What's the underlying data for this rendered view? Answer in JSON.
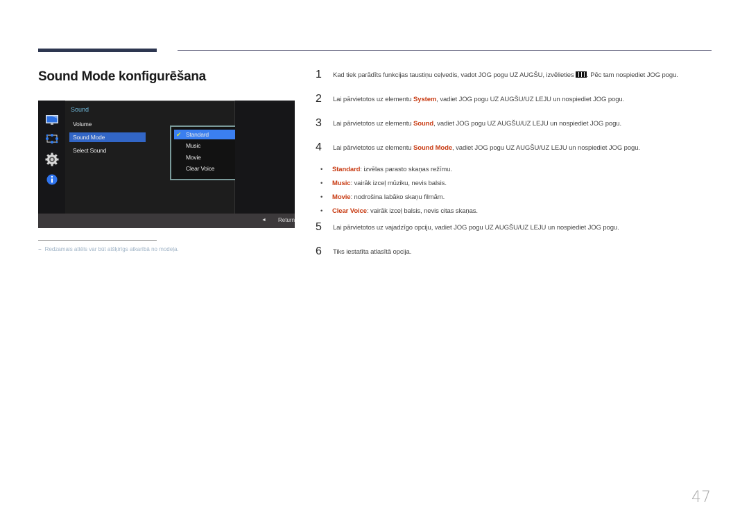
{
  "page": {
    "title": "Sound Mode konfigurēšana",
    "number": "47"
  },
  "osd": {
    "icons": [
      "monitor-icon",
      "resize-icon",
      "gear-icon",
      "info-icon"
    ],
    "section": "Sound",
    "menu_items": [
      {
        "label": "Volume",
        "active": false
      },
      {
        "label": "Sound Mode",
        "active": true
      },
      {
        "label": "Select Sound",
        "active": false
      }
    ],
    "submenu_items": [
      {
        "label": "Standard",
        "selected": true
      },
      {
        "label": "Music",
        "selected": false
      },
      {
        "label": "Movie",
        "selected": false
      },
      {
        "label": "Clear Voice",
        "selected": false
      }
    ],
    "footer": {
      "arrow": "◄",
      "return_label": "Return"
    },
    "colors": {
      "highlight": "#3266c6",
      "section": "#6fb7d8",
      "check": "#d8e830"
    }
  },
  "note": {
    "dash": "−",
    "text": "Redzamais attēls var būt atšķirīgs atkarībā no modeļa."
  },
  "steps": [
    {
      "num": "1",
      "before": "Kad tiek parādīts funkcijas taustiņu ceļvedis, vadot JOG pogu UZ AUGŠU, izvēlieties ",
      "highlight": "",
      "after": ". Pēc tam nospiediet JOG pogu.",
      "icon": "menu-icon"
    },
    {
      "num": "2",
      "before": "Lai pārvietotos uz elementu ",
      "highlight": "System",
      "after": ", vadiet JOG pogu UZ AUGŠU/UZ LEJU un nospiediet JOG pogu."
    },
    {
      "num": "3",
      "before": "Lai pārvietotos uz elementu ",
      "highlight": "Sound",
      "after": ", vadiet JOG pogu UZ AUGŠU/UZ LEJU un nospiediet JOG pogu."
    },
    {
      "num": "4",
      "before": "Lai pārvietotos uz elementu ",
      "highlight": "Sound Mode",
      "after": ", vadiet JOG pogu UZ AUGŠU/UZ LEJU un nospiediet JOG pogu."
    },
    {
      "num": "5",
      "before": "Lai pārvietotos uz vajadzīgo opciju, vadiet JOG pogu UZ AUGŠU/UZ LEJU un nospiediet JOG pogu.",
      "highlight": "",
      "after": ""
    },
    {
      "num": "6",
      "before": "Tiks iestatīta atlasītā opcija.",
      "highlight": "",
      "after": ""
    }
  ],
  "bullets": [
    {
      "dot": "•",
      "term": "Standard",
      "desc": ": izvēlas parasto skaņas režīmu."
    },
    {
      "dot": "•",
      "term": "Music",
      "desc": ": vairāk izceļ mūziku, nevis balsis."
    },
    {
      "dot": "•",
      "term": "Movie",
      "desc": ": nodrošina labāko skaņu filmām."
    },
    {
      "dot": "•",
      "term": "Clear Voice",
      "desc": ": vairāk izceļ balsis, nevis citas skaņas."
    }
  ],
  "colors": {
    "accent": "#c83c14",
    "rule": "#2d3650"
  }
}
